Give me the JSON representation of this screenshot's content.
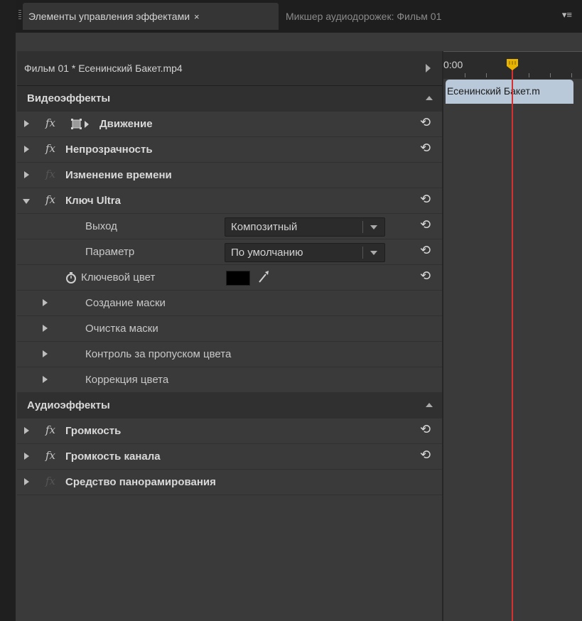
{
  "tabs": {
    "effect_controls": "Элементы управления эффектами",
    "close_symbol": "×",
    "audio_mixer": "Микшер аудиодорожек: Фильм 01",
    "menu_symbol": "▾≡"
  },
  "header": {
    "clip_name": "Фильм 01 * Есенинский Бакет.mp4"
  },
  "sections": {
    "video": "Видеоэффекты",
    "audio": "Аудиоэффекты"
  },
  "fx_symbol": "fx",
  "reset_symbol": "⟲",
  "video_effects": [
    {
      "name": "Движение"
    },
    {
      "name": "Непрозрачность"
    },
    {
      "name": "Изменение времени"
    },
    {
      "name": "Ключ Ultra"
    }
  ],
  "ultra_key": {
    "output_label": "Выход",
    "output_value": "Композитный",
    "setting_label": "Параметр",
    "setting_value": "По умолчанию",
    "key_color_label": "Ключевой цвет",
    "key_color": "#000000",
    "groups": [
      "Создание маски",
      "Очистка маски",
      "Контроль за пропуском цвета",
      "Коррекция цвета"
    ]
  },
  "audio_effects": [
    {
      "name": "Громкость"
    },
    {
      "name": "Громкость канала"
    },
    {
      "name": "Средство панорамирования"
    }
  ],
  "timeline": {
    "timecode": "0:00",
    "clip_label": "Есенинский Бакет.m"
  },
  "colors": {
    "playhead": "#d63030",
    "playhead_handle": "#e8b400",
    "clip": "#b9c9d9"
  }
}
